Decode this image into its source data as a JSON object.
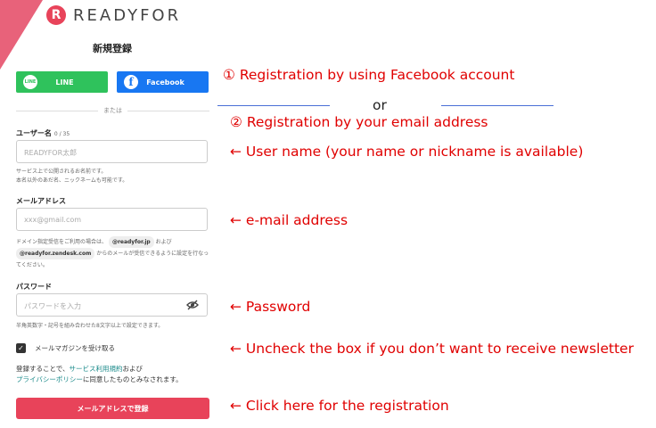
{
  "brand": {
    "name": "READYFOR",
    "mark": "R"
  },
  "page_title": "新規登録",
  "sns": {
    "line_icon": "LINE",
    "line_label": "LINE",
    "facebook_icon": "f",
    "facebook_label": "Facebook"
  },
  "divider": "または",
  "username": {
    "label": "ユーザー名",
    "count": "0 / 35",
    "placeholder": "READYFOR太郎",
    "help_line1": "サービス上で公開されるお名前です。",
    "help_line2": "本名以外のあだ名、ニックネームも可能です。"
  },
  "email": {
    "label": "メールアドレス",
    "placeholder": "xxx@gmail.com",
    "help_prefix": "ドメイン指定受信をご利用の場合は、",
    "domain1": "@readyfor.jp",
    "help_and": "および",
    "domain2": "@readyfor.zendesk.com",
    "help_suffix": "からのメールが受信できるように設定を行なってください。"
  },
  "password": {
    "label": "パスワード",
    "placeholder": "パスワードを入力",
    "help": "半角英数字・記号を組み合わせた8文字以上で設定できます。"
  },
  "newsletter": {
    "label": "メールマガジンを受け取る",
    "checked": true
  },
  "terms": {
    "prefix": "登録することで、",
    "link1": "サービス利用規約",
    "and": "および",
    "link2": "プライバシーポリシー",
    "suffix": "に同意したものとみなされます。"
  },
  "submit_label": "メールアドレスで登録",
  "annotations": {
    "a1": "① Registration by using Facebook account",
    "or": "or",
    "a2": "② Registration by your email address",
    "a3": "← User name (your name or nickname is available)",
    "a4": "← e-mail address",
    "a5": "← Password",
    "a6": "← Uncheck the box if you don’t want to receive newsletter",
    "a7": "← Click here for the registration"
  },
  "colors": {
    "brand": "#e8435a",
    "line": "#2fc25c",
    "facebook": "#1877f2",
    "annotation": "#e00000"
  }
}
